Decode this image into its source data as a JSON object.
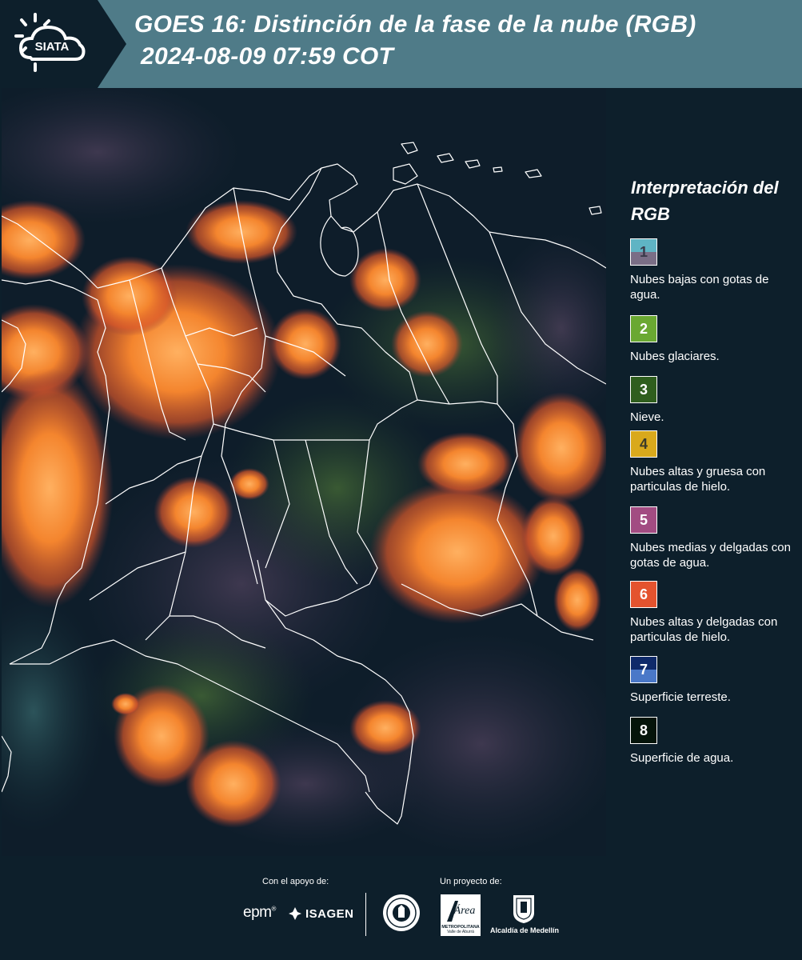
{
  "header": {
    "logo_text": "SIATA",
    "title_line1": "GOES 16: Distinción de la fase de la nube (RGB)",
    "title_line2": "2024-08-09 07:59 COT"
  },
  "legend": {
    "title": "Interpretación del RGB",
    "items": [
      {
        "number": "1",
        "label": "Nubes bajas con gotas de agua.",
        "color_top": "#5fb4c4",
        "color_bottom": "#7a6e86",
        "text_color": "#3a3a4a"
      },
      {
        "number": "2",
        "label": "Nubes glaciares.",
        "color_top": "#6aa832",
        "color_bottom": "#6aa832",
        "text_color": "#ffffff"
      },
      {
        "number": "3",
        "label": "Nieve.",
        "color_top": "#2f5e1e",
        "color_bottom": "#2f5e1e",
        "text_color": "#ffffff"
      },
      {
        "number": "4",
        "label": "Nubes altas y gruesa con particulas de hielo.",
        "color_top": "#d9a91c",
        "color_bottom": "#d9a91c",
        "text_color": "#3a3a2a"
      },
      {
        "number": "5",
        "label": "Nubes medias y delgadas con gotas de agua.",
        "color_top": "#a24c82",
        "color_bottom": "#a24c82",
        "text_color": "#ffffff"
      },
      {
        "number": "6",
        "label": "Nubes altas y delgadas con particulas de hielo.",
        "color_top": "#e4532e",
        "color_bottom": "#e4532e",
        "text_color": "#ffffff"
      },
      {
        "number": "7",
        "label": "Superficie terreste.",
        "color_top": "#0f2a6a",
        "color_bottom": "#4a78c8",
        "text_color": "#ffffff"
      },
      {
        "number": "8",
        "label": "Superficie de agua.",
        "color_top": "#05140a",
        "color_bottom": "#05140a",
        "text_color": "#ffffff"
      }
    ]
  },
  "footer": {
    "support_label": "Con el apoyo de:",
    "project_label": "Un proyecto de:",
    "epm": "epm",
    "isagen": "ISAGEN",
    "area_text": "Área",
    "area_sub1": "METROPOLITANA",
    "area_sub2": "Valle de Aburrá",
    "alcaldia": "Alcaldía de Medellín"
  },
  "colors": {
    "header_bg": "#4f7b88",
    "panel_bg": "#0d1f2b",
    "cloud_orange": "#f07a2a",
    "boundary": "#ffffff"
  }
}
